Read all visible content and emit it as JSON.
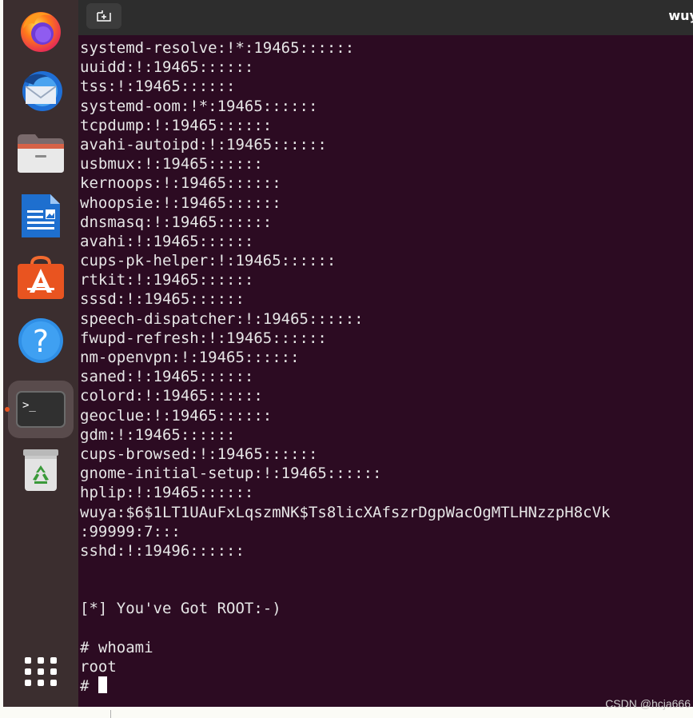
{
  "window": {
    "title": "wuy"
  },
  "dock": {
    "items": [
      {
        "name": "firefox",
        "icon": "firefox-icon",
        "active": false
      },
      {
        "name": "thunderbird",
        "icon": "thunderbird-icon",
        "active": false
      },
      {
        "name": "files",
        "icon": "files-icon",
        "active": false
      },
      {
        "name": "writer",
        "icon": "libreoffice-writer-icon",
        "active": false
      },
      {
        "name": "app-center",
        "icon": "app-center-icon",
        "active": false
      },
      {
        "name": "help",
        "icon": "help-icon",
        "active": false
      },
      {
        "name": "terminal",
        "icon": "terminal-icon",
        "active": true
      },
      {
        "name": "trash",
        "icon": "trash-icon",
        "active": false
      },
      {
        "name": "show-apps",
        "icon": "app-grid-icon",
        "active": false
      }
    ],
    "help_glyph": "?",
    "terminal_glyph": ">_"
  },
  "terminal": {
    "lines": [
      "systemd-resolve:!*:19465::::::",
      "uuidd:!:19465::::::",
      "tss:!:19465::::::",
      "systemd-oom:!*:19465::::::",
      "tcpdump:!:19465::::::",
      "avahi-autoipd:!:19465::::::",
      "usbmux:!:19465::::::",
      "kernoops:!:19465::::::",
      "whoopsie:!:19465::::::",
      "dnsmasq:!:19465::::::",
      "avahi:!:19465::::::",
      "cups-pk-helper:!:19465::::::",
      "rtkit:!:19465::::::",
      "sssd:!:19465::::::",
      "speech-dispatcher:!:19465::::::",
      "fwupd-refresh:!:19465::::::",
      "nm-openvpn:!:19465::::::",
      "saned:!:19465::::::",
      "colord:!:19465::::::",
      "geoclue:!:19465::::::",
      "gdm:!:19465::::::",
      "cups-browsed:!:19465::::::",
      "gnome-initial-setup:!:19465::::::",
      "hplip:!:19465::::::",
      "wuya:$6$1LT1UAuFxLqszmNK$Ts8licXAfszrDgpWacOgMTLHNzzpH8cVk",
      ":99999:7:::",
      "sshd:!:19496::::::",
      "",
      "",
      "[*] You've Got ROOT:-)",
      "",
      "# whoami",
      "root"
    ],
    "prompt": "# "
  },
  "watermark": "CSDN @hcja666",
  "colors": {
    "terminal_bg": "#2c0b22",
    "dock_bg": "#3b2e2f",
    "header_bg": "#2d2d2d",
    "accent": "#e95420"
  }
}
